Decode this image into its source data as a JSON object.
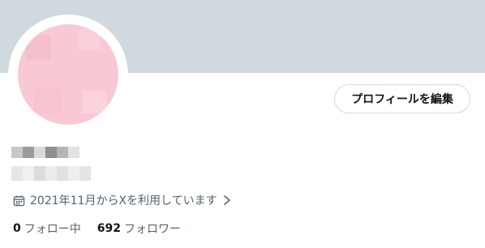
{
  "profile": {
    "edit_button_label": "プロフィールを編集",
    "joined_text": "2021年11月からXを利用しています",
    "following_count": "0",
    "following_label": "フォロー中",
    "followers_count": "692",
    "followers_label": "フォロワー"
  },
  "icons": {
    "calendar": "calendar-icon",
    "chevron": "chevron-right-icon"
  },
  "colors": {
    "banner": "#cfd9de",
    "avatar": "#f8c8d4",
    "secondary_text": "#536471",
    "primary_text": "#0f1419"
  }
}
